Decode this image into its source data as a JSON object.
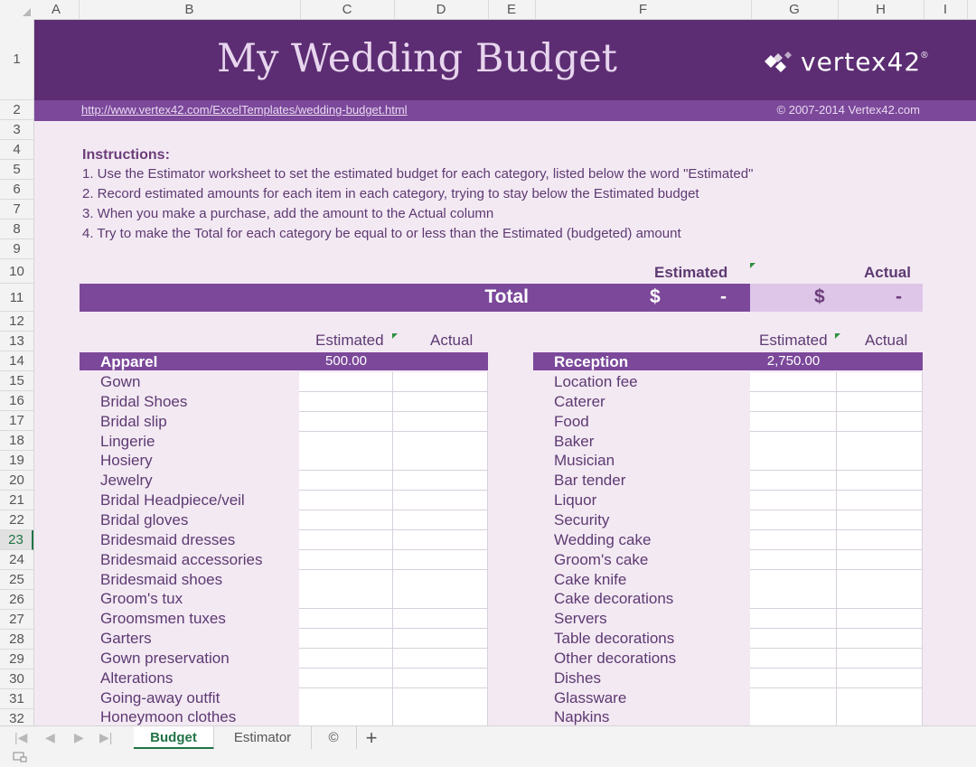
{
  "columns": [
    "A",
    "B",
    "C",
    "D",
    "E",
    "F",
    "G",
    "H",
    "I"
  ],
  "rows": [
    "1",
    "2",
    "3",
    "4",
    "5",
    "6",
    "7",
    "8",
    "9",
    "10",
    "11",
    "12",
    "13",
    "14",
    "15",
    "16",
    "17",
    "18",
    "19",
    "20",
    "21",
    "22",
    "23",
    "24",
    "25",
    "26",
    "27",
    "28",
    "29",
    "30",
    "31",
    "32"
  ],
  "selected_row": "23",
  "banner": {
    "title": "My Wedding Budget",
    "brand": "vertex42",
    "registered": "®"
  },
  "subbar": {
    "url": "http://www.vertex42.com/ExcelTemplates/wedding-budget.html",
    "copyright": "© 2007-2014 Vertex42.com"
  },
  "instructions": {
    "heading": "Instructions:",
    "items": [
      "1. Use the Estimator worksheet to set the estimated budget for each category, listed below the word \"Estimated\"",
      "2. Record estimated amounts for each item in each category, trying to stay below the Estimated budget",
      "3. When you make a purchase, add the amount to the Actual column",
      "4. Try to make the Total for each category be equal to or less than the Estimated (budgeted) amount"
    ]
  },
  "totals": {
    "estimated_header": "Estimated",
    "actual_header": "Actual",
    "label": "Total",
    "estimated_currency": "$",
    "estimated_value": "-",
    "actual_currency": "$",
    "actual_value": "-"
  },
  "apparel": {
    "estimated_header": "Estimated",
    "actual_header": "Actual",
    "category": "Apparel",
    "estimate": "500.00",
    "items": [
      "Gown",
      "Bridal Shoes",
      "Bridal slip",
      "Lingerie",
      "Hosiery",
      "Jewelry",
      "Bridal Headpiece/veil",
      "Bridal gloves",
      "Bridesmaid dresses",
      "Bridesmaid accessories",
      "Bridesmaid shoes",
      "Groom's tux",
      "Groomsmen tuxes",
      "Garters",
      "Gown preservation",
      "Alterations",
      "Going-away outfit",
      "Honeymoon clothes"
    ]
  },
  "reception": {
    "estimated_header": "Estimated",
    "actual_header": "Actual",
    "category": "Reception",
    "estimate": "2,750.00",
    "items": [
      "Location fee",
      "Caterer",
      "Food",
      "Baker",
      "Musician",
      "Bar tender",
      "Liquor",
      "Security",
      "Wedding cake",
      "Groom's cake",
      "Cake knife",
      "Cake decorations",
      "Servers",
      "Table decorations",
      "Other decorations",
      "Dishes",
      "Glassware",
      "Napkins"
    ]
  },
  "tabs": {
    "budget": "Budget",
    "estimator": "Estimator",
    "copyright": "©",
    "add": "+"
  },
  "colors": {
    "banner": "#5c2d73",
    "accent": "#7b489a",
    "sheet_bg": "#f3e9f3",
    "active_tab": "#217346"
  }
}
